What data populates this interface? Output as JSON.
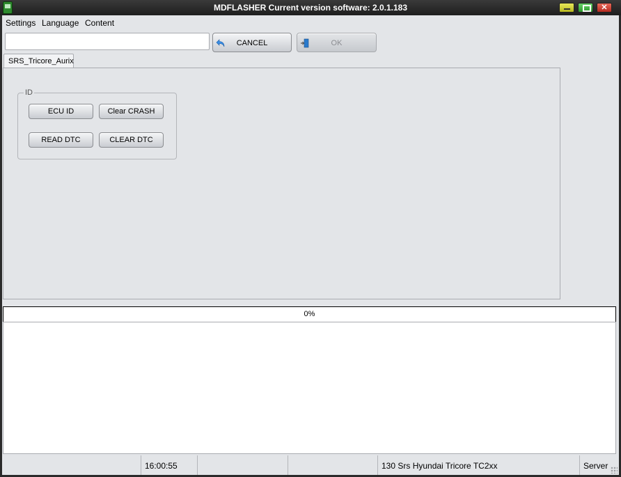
{
  "window": {
    "title": "MDFLASHER  Current version software: 2.0.1.183"
  },
  "menu": {
    "items": [
      {
        "label": "Settings"
      },
      {
        "label": "Language"
      },
      {
        "label": "Content"
      }
    ]
  },
  "toolbar": {
    "path_value": "",
    "cancel_label": "CANCEL",
    "ok_label": "OK"
  },
  "tabs": [
    {
      "label": "SRS_Tricore_Aurix",
      "selected": true
    }
  ],
  "group": {
    "title": "ID",
    "buttons": [
      {
        "label": "ECU ID"
      },
      {
        "label": "Clear CRASH"
      },
      {
        "label": "READ DTC"
      },
      {
        "label": "CLEAR DTC"
      }
    ]
  },
  "progress": {
    "text": "0%",
    "value": 0
  },
  "status": {
    "time": "16:00:55",
    "ecu": "130 Srs Hyundai Tricore TC2xx",
    "mode": "Server"
  },
  "colors": {
    "title_bar": "#1e1e1e",
    "client_bg": "#e3e5e8",
    "cancel_icon": "#3a8ee6",
    "ok_icon": "#2a7acc"
  },
  "icons": {
    "app": "app-icon",
    "cancel": "undo-arrow-icon",
    "ok": "exit-door-icon"
  }
}
